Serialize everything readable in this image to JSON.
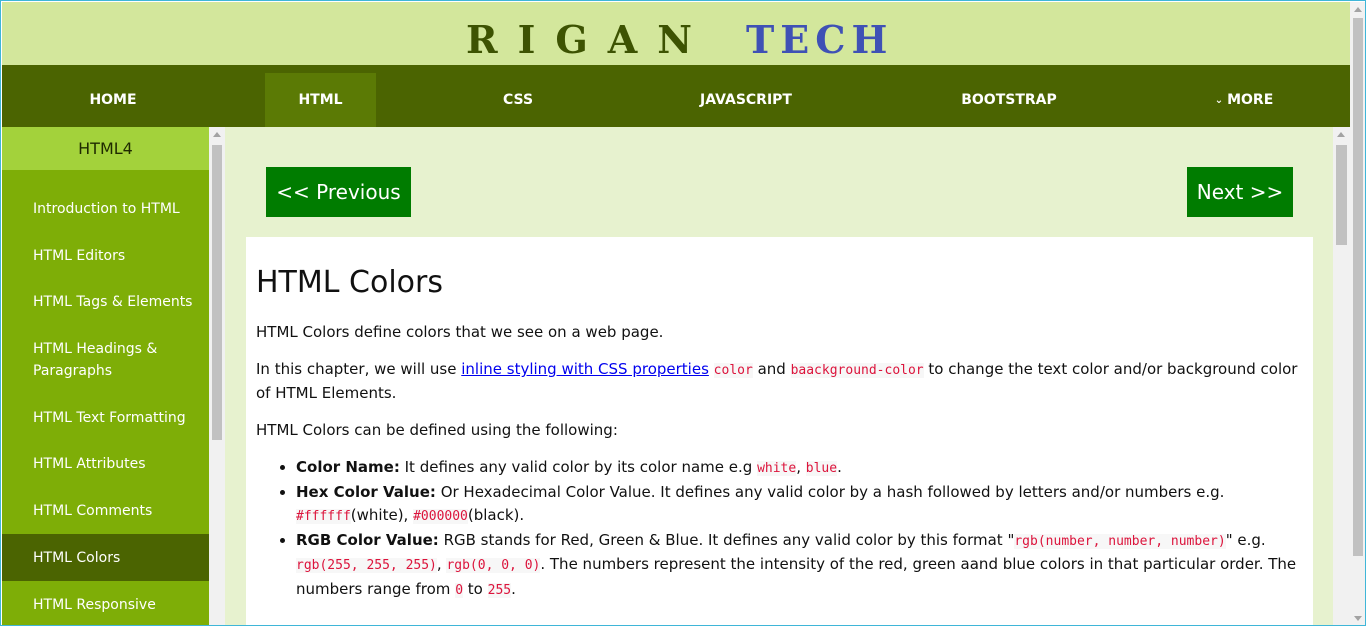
{
  "brand": {
    "part1": "RIGAN",
    "part2": "TECH"
  },
  "nav": {
    "items": [
      {
        "label": "HOME"
      },
      {
        "label": "HTML"
      },
      {
        "label": "CSS"
      },
      {
        "label": "JAVASCRIPT"
      },
      {
        "label": "BOOTSTRAP"
      },
      {
        "label": "MORE"
      }
    ],
    "active": "HTML"
  },
  "sidebar": {
    "heading": "HTML4",
    "items": [
      {
        "label": "Introduction to HTML"
      },
      {
        "label": "HTML Editors"
      },
      {
        "label": "HTML Tags & Elements"
      },
      {
        "label": "HTML Headings & Paragraphs"
      },
      {
        "label": "HTML Text Formatting"
      },
      {
        "label": "HTML Attributes"
      },
      {
        "label": "HTML Comments"
      },
      {
        "label": "HTML Colors"
      },
      {
        "label": "HTML Responsive"
      }
    ],
    "active": "HTML Colors"
  },
  "pager": {
    "prev": "<< Previous",
    "next": "Next >>"
  },
  "article": {
    "title": "HTML Colors",
    "p1": "HTML Colors define colors that we see on a web page.",
    "p2_prefix": "In this chapter, we will use ",
    "p2_link": "inline styling with CSS properties",
    "p2_code1": "color",
    "p2_and": " and ",
    "p2_code2": "baackground-color",
    "p2_suffix": " to change the text color and/or background color of HTML Elements.",
    "p3": "HTML Colors can be defined using the following:",
    "list": {
      "name_label": "Color Name:",
      "name_text": " It defines any valid color by its color name e.g ",
      "name_code1": "white",
      "name_comma": ", ",
      "name_code2": "blue",
      "name_end": ".",
      "hex_label": "Hex Color Value:",
      "hex_text": " Or Hexadecimal Color Value. It defines any valid color by a hash followed by letters and/or numbers e.g. ",
      "hex_code1": "#ffffff",
      "hex_mid": "(white), ",
      "hex_code2": "#000000",
      "hex_end": "(black).",
      "rgb_label": "RGB Color Value:",
      "rgb_text1": " RGB stands for Red, Green & Blue. It defines any valid color by this format \"",
      "rgb_code_fmt": "rgb(number, number, number)",
      "rgb_text2": "\" e.g. ",
      "rgb_code1": "rgb(255, 255, 255)",
      "rgb_comma": ", ",
      "rgb_code2": "rgb(0, 0, 0)",
      "rgb_text3": ". The numbers represent the intensity of the red, green aand blue colors in that particular order. The numbers range from ",
      "rgb_code3": "0",
      "rgb_to": " to ",
      "rgb_code4": "255",
      "rgb_end": "."
    }
  },
  "colors": {
    "brand_bg": "#d3e79c",
    "nav_bg": "#4b6401",
    "sidebar_bg": "#7eae07",
    "button_bg": "#007c00",
    "main_bg": "#e7f2cf",
    "code": "#dc143c"
  }
}
